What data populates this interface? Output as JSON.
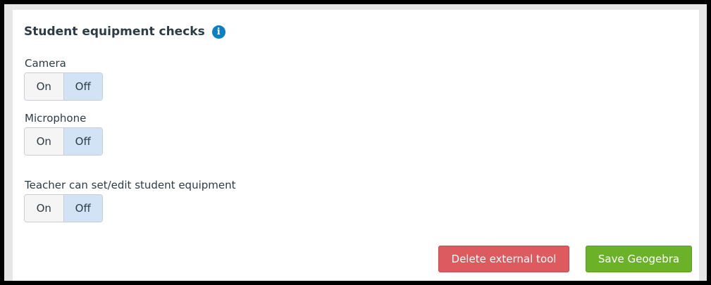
{
  "section": {
    "title": "Student equipment checks",
    "info_icon": "info-icon",
    "info_symbol": "i"
  },
  "fields": [
    {
      "label": "Camera",
      "on_label": "On",
      "off_label": "Off",
      "selected": "Off"
    },
    {
      "label": "Microphone",
      "on_label": "On",
      "off_label": "Off",
      "selected": "Off"
    },
    {
      "label": "Teacher can set/edit student equipment",
      "on_label": "On",
      "off_label": "Off",
      "selected": "Off"
    }
  ],
  "actions": {
    "delete_label": "Delete external tool",
    "save_label": "Save Geogebra"
  },
  "colors": {
    "selected_option": "#d3e3f6",
    "delete_button": "#dd5a5f",
    "save_button": "#6bb229",
    "info_icon": "#0b7ec4"
  }
}
